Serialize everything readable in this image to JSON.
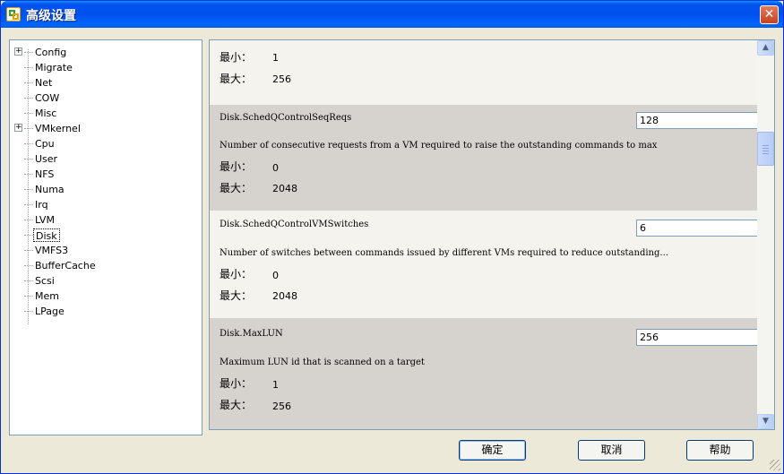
{
  "window": {
    "title": "高级设置",
    "close_label": "✕"
  },
  "tree": {
    "items": [
      {
        "label": "Config",
        "expandable": true,
        "selected": false
      },
      {
        "label": "Migrate",
        "expandable": false,
        "selected": false
      },
      {
        "label": "Net",
        "expandable": false,
        "selected": false
      },
      {
        "label": "COW",
        "expandable": false,
        "selected": false
      },
      {
        "label": "Misc",
        "expandable": false,
        "selected": false
      },
      {
        "label": "VMkernel",
        "expandable": true,
        "selected": false
      },
      {
        "label": "Cpu",
        "expandable": false,
        "selected": false
      },
      {
        "label": "User",
        "expandable": false,
        "selected": false
      },
      {
        "label": "NFS",
        "expandable": false,
        "selected": false
      },
      {
        "label": "Numa",
        "expandable": false,
        "selected": false
      },
      {
        "label": "Irq",
        "expandable": false,
        "selected": false
      },
      {
        "label": "LVM",
        "expandable": false,
        "selected": false
      },
      {
        "label": "Disk",
        "expandable": false,
        "selected": true
      },
      {
        "label": "VMFS3",
        "expandable": false,
        "selected": false
      },
      {
        "label": "BufferCache",
        "expandable": false,
        "selected": false
      },
      {
        "label": "Scsi",
        "expandable": false,
        "selected": false
      },
      {
        "label": "Mem",
        "expandable": false,
        "selected": false
      },
      {
        "label": "LPage",
        "expandable": false,
        "selected": false
      }
    ],
    "expander_symbol": "+"
  },
  "settings": {
    "min_label": "最小：",
    "max_label": "最大：",
    "partial": {
      "min": "1",
      "max": "256"
    },
    "entries": [
      {
        "name": "Disk.SchedQControlSeqReqs",
        "value": "128",
        "description": "Number of consecutive requests from a VM required to raise the outstanding commands to max",
        "min": "0",
        "max": "2048"
      },
      {
        "name": "Disk.SchedQControlVMSwitches",
        "value": "6",
        "description": "Number of switches between commands issued by different VMs required to reduce outstanding...",
        "min": "0",
        "max": "2048"
      },
      {
        "name": "Disk.MaxLUN",
        "value": "256",
        "description": "Maximum LUN id that is scanned on a target",
        "min": "1",
        "max": "256"
      }
    ]
  },
  "scrollbar": {
    "up_arrow": "▲",
    "down_arrow": "▼"
  },
  "buttons": {
    "ok": "确定",
    "cancel": "取消",
    "help": "帮助"
  },
  "colors": {
    "titlebar": "#0053ee",
    "shaded_row": "#d6d3ce",
    "light_row": "#f4f3ee",
    "face": "#ece9d8"
  }
}
